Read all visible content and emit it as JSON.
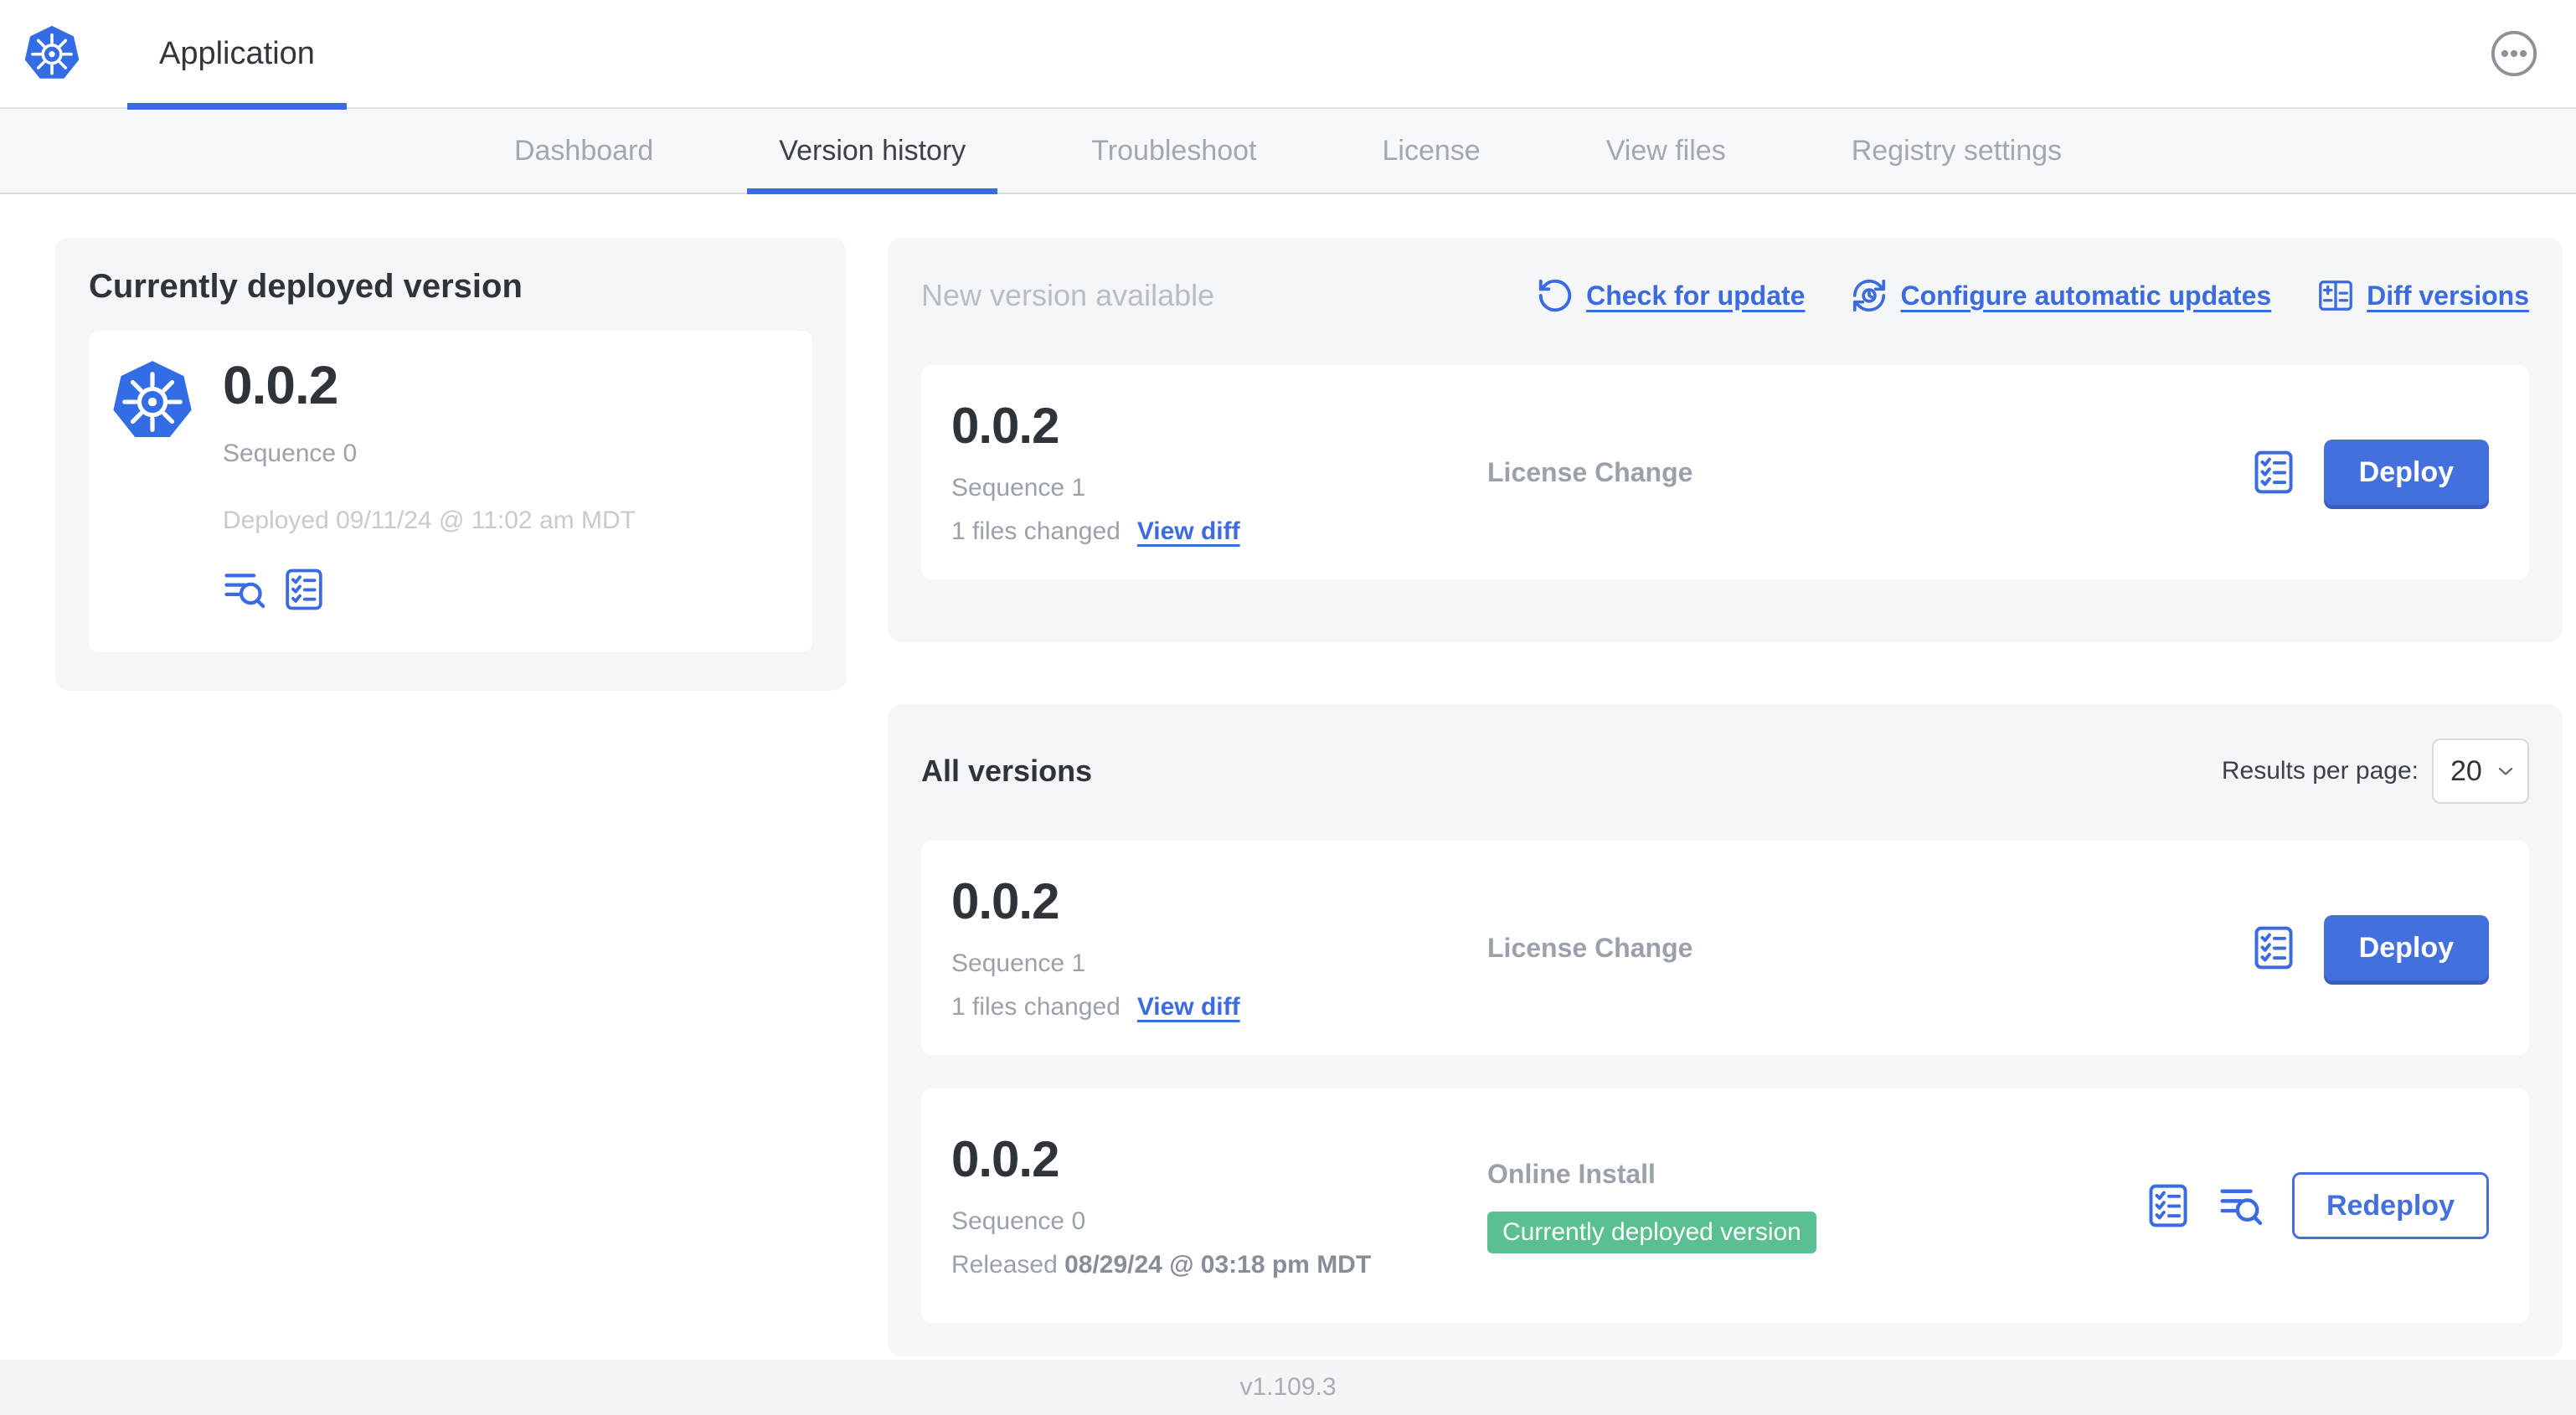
{
  "app": {
    "title": "Application"
  },
  "topbar": {
    "menu_icon": "dots-menu-icon"
  },
  "nav": {
    "tabs": [
      {
        "label": "Dashboard",
        "active": false
      },
      {
        "label": "Version history",
        "active": true
      },
      {
        "label": "Troubleshoot",
        "active": false
      },
      {
        "label": "License",
        "active": false
      },
      {
        "label": "View files",
        "active": false
      },
      {
        "label": "Registry settings",
        "active": false
      }
    ]
  },
  "current": {
    "heading": "Currently deployed version",
    "version": "0.0.2",
    "sequence": "Sequence 0",
    "deployed": "Deployed 09/11/24 @ 11:02 am MDT",
    "icons": [
      "logs-icon",
      "checklist-icon"
    ]
  },
  "new_version": {
    "heading": "New version available",
    "actions": [
      {
        "label": "Check for update",
        "icon": "refresh-icon"
      },
      {
        "label": "Configure automatic updates",
        "icon": "clock-refresh-icon"
      },
      {
        "label": "Diff versions",
        "icon": "diff-icon"
      }
    ],
    "row": {
      "version": "0.0.2",
      "sequence": "Sequence 1",
      "files_changed": "1 files changed",
      "view_diff": "View diff",
      "source": "License Change",
      "action_label": "Deploy"
    }
  },
  "all_versions": {
    "heading": "All versions",
    "results_per_page_label": "Results per page:",
    "results_per_page_value": "20",
    "rows": [
      {
        "version": "0.0.2",
        "sequence": "Sequence 1",
        "files_changed": "1 files changed",
        "view_diff": "View diff",
        "source": "License Change",
        "action_label": "Deploy"
      },
      {
        "version": "0.0.2",
        "sequence": "Sequence 0",
        "released_prefix": "Released ",
        "released_date": "08/29/24 @ 03:18 pm MDT",
        "source": "Online Install",
        "badge": "Currently deployed version",
        "action_label": "Redeploy"
      }
    ]
  },
  "footer": {
    "version": "v1.109.3"
  },
  "colors": {
    "accent_blue": "#3b6be0",
    "button_blue": "#4470de",
    "button_blue_shadow": "#3a5ec6",
    "kubernetes_blue": "#326de6",
    "badge_green": "#5bc091",
    "card_gray": "#f4f6f8",
    "nav_gray": "#f7f8fa",
    "muted_text": "#9ba1ab",
    "faint_text": "#c6cad1"
  }
}
